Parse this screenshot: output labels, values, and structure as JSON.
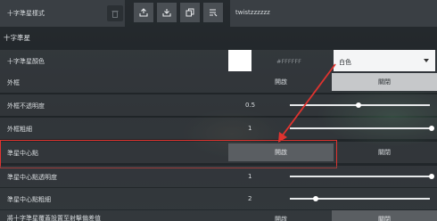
{
  "toolbar": {
    "preset_name": "十字準星樣式",
    "text_value": "twistzzzzzz",
    "icons": [
      "trash-icon",
      "upload-icon",
      "download-icon",
      "copy-icon",
      "paste-list-icon"
    ]
  },
  "section_title": "十字準星",
  "rows": {
    "color": {
      "label": "十字準星顏色",
      "hex": "#FFFFFF",
      "dropdown_value": "白色",
      "swatch_color": "#FFFFFF"
    },
    "outline": {
      "label": "外框",
      "on": "開啟",
      "off": "關閉"
    },
    "outline_opacity": {
      "label": "外框不透明度",
      "value": "0.5",
      "level": 0.5
    },
    "outline_thickness": {
      "label": "外框粗細",
      "value": "1",
      "level": 1.0
    },
    "center_dot": {
      "label": "準星中心點",
      "on": "開啟",
      "off": "關閉"
    },
    "center_opacity": {
      "label": "準星中心點透明度",
      "value": "1",
      "level": 1.0
    },
    "center_thickness": {
      "label": "準星中心點粗細",
      "value": "2",
      "level": 0.12
    },
    "override": {
      "label": "將十字準星覆蓋設置至射擊偏差值",
      "on": "開啟",
      "off": "關閉"
    }
  },
  "colors": {
    "highlight": "#E0332F",
    "accent": "#C6C8CA"
  }
}
